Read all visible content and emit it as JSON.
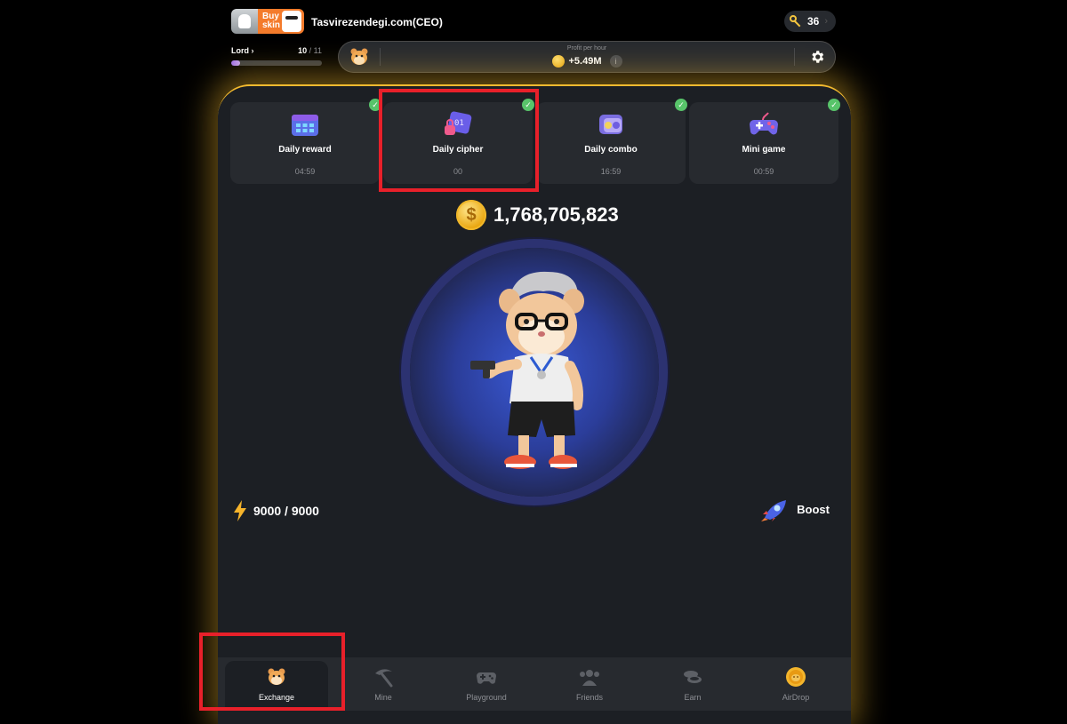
{
  "header": {
    "buy_skin_label": "Buy skin",
    "username": "Tasvirezendegi.com(CEO)",
    "keys_count": "36"
  },
  "level": {
    "name": "Lord",
    "chevron": "›",
    "current": "10",
    "total": "/ 11",
    "progress": 0.1
  },
  "profit": {
    "label": "Profit per hour",
    "value": "+5.49M",
    "info_icon": "i"
  },
  "daily_cards": [
    {
      "title": "Daily reward",
      "timer": "04:59",
      "completed": true,
      "icon": "calendar-icon"
    },
    {
      "title": "Daily cipher",
      "timer": "00",
      "completed": true,
      "icon": "cipher-icon"
    },
    {
      "title": "Daily combo",
      "timer": "16:59",
      "completed": true,
      "icon": "combo-icon"
    },
    {
      "title": "Mini game",
      "timer": "00:59",
      "completed": true,
      "icon": "gamepad-icon"
    }
  ],
  "balance": {
    "coin_symbol": "$",
    "value": "1,768,705,823"
  },
  "energy": {
    "value": "9000 / 9000"
  },
  "boost": {
    "label": "Boost"
  },
  "nav": [
    {
      "label": "Exchange",
      "icon": "hamster-icon",
      "active": true
    },
    {
      "label": "Mine",
      "icon": "pickaxe-icon",
      "active": false
    },
    {
      "label": "Playground",
      "icon": "gamepad-icon",
      "active": false
    },
    {
      "label": "Friends",
      "icon": "friends-icon",
      "active": false
    },
    {
      "label": "Earn",
      "icon": "coins-icon",
      "active": false
    },
    {
      "label": "AirDrop",
      "icon": "airdrop-coin-icon",
      "active": false
    }
  ],
  "colors": {
    "background": "#000000",
    "panel": "#1c1f24",
    "card": "#272a2f",
    "accent_glow": "#f3ba2f",
    "highlight": "#e8202a",
    "check": "#58c46a"
  }
}
